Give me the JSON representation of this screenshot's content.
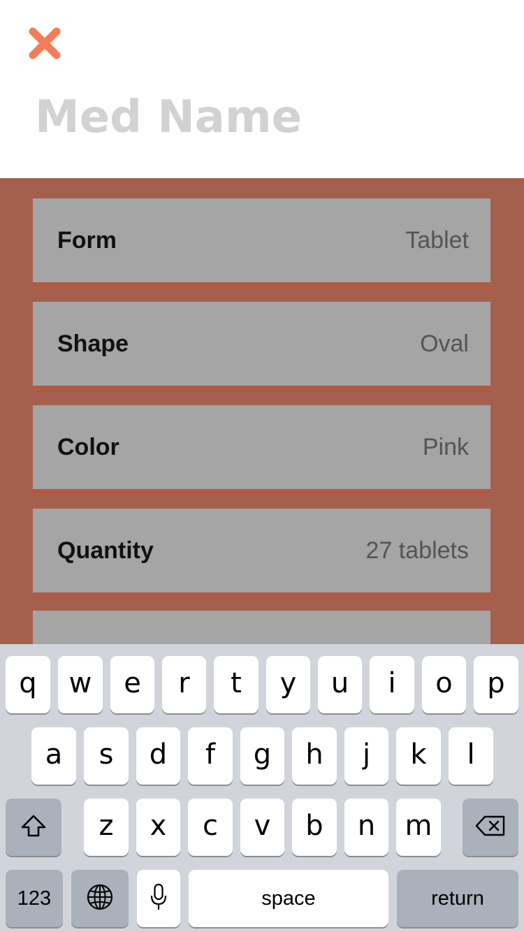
{
  "header": {
    "close_icon": "close-icon",
    "accent_color": "#f27e57",
    "med_name_placeholder": "Med Name",
    "med_name_value": ""
  },
  "form": {
    "background_color": "#a5604d",
    "rows": [
      {
        "label": "Form",
        "value": "Tablet"
      },
      {
        "label": "Shape",
        "value": "Oval"
      },
      {
        "label": "Color",
        "value": "Pink"
      },
      {
        "label": "Quantity",
        "value": "27 tablets"
      },
      {
        "label": "",
        "value": ""
      }
    ]
  },
  "keyboard": {
    "row1": [
      "q",
      "w",
      "e",
      "r",
      "t",
      "y",
      "u",
      "i",
      "o",
      "p"
    ],
    "row2": [
      "a",
      "s",
      "d",
      "f",
      "g",
      "h",
      "j",
      "k",
      "l"
    ],
    "row3": [
      "z",
      "x",
      "c",
      "v",
      "b",
      "n",
      "m"
    ],
    "shift_icon": "shift-icon",
    "delete_icon": "backspace-icon",
    "numbers_label": "123",
    "globe_icon": "globe-icon",
    "mic_icon": "microphone-icon",
    "space_label": "space",
    "return_label": "return"
  }
}
